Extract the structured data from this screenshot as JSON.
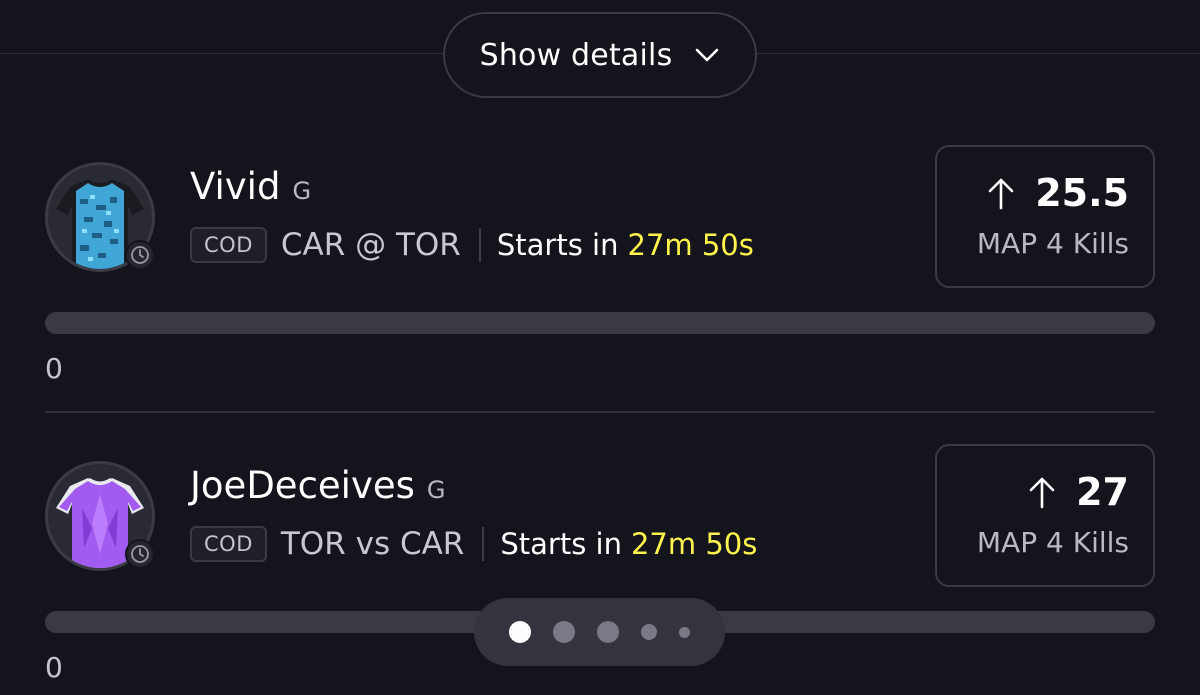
{
  "header": {
    "details_label": "Show details"
  },
  "cards": [
    {
      "player_name": "Vivid",
      "position": "G",
      "league": "COD",
      "matchup": "CAR @ TOR",
      "starts_label": "Starts in",
      "countdown": "27m 50s",
      "line": "25.5",
      "stat": "MAP 4 Kills",
      "direction_icon": "arrow-up-icon",
      "progress": 0,
      "progress_label": "0",
      "jersey_color": "#3fa6d6",
      "jersey_trim": "#1a1a1f"
    },
    {
      "player_name": "JoeDeceives",
      "position": "G",
      "league": "COD",
      "matchup": "TOR vs CAR",
      "starts_label": "Starts in",
      "countdown": "27m 50s",
      "line": "27",
      "stat": "MAP 4 Kills",
      "direction_icon": "arrow-up-icon",
      "progress": 0,
      "progress_label": "0",
      "jersey_color": "#a25bf0",
      "jersey_trim": "#e8e8ee"
    }
  ],
  "pager": {
    "total": 5,
    "active": 0
  },
  "colors": {
    "background": "#14141c",
    "countdown": "#fff34d",
    "border": "#3a3a46"
  }
}
